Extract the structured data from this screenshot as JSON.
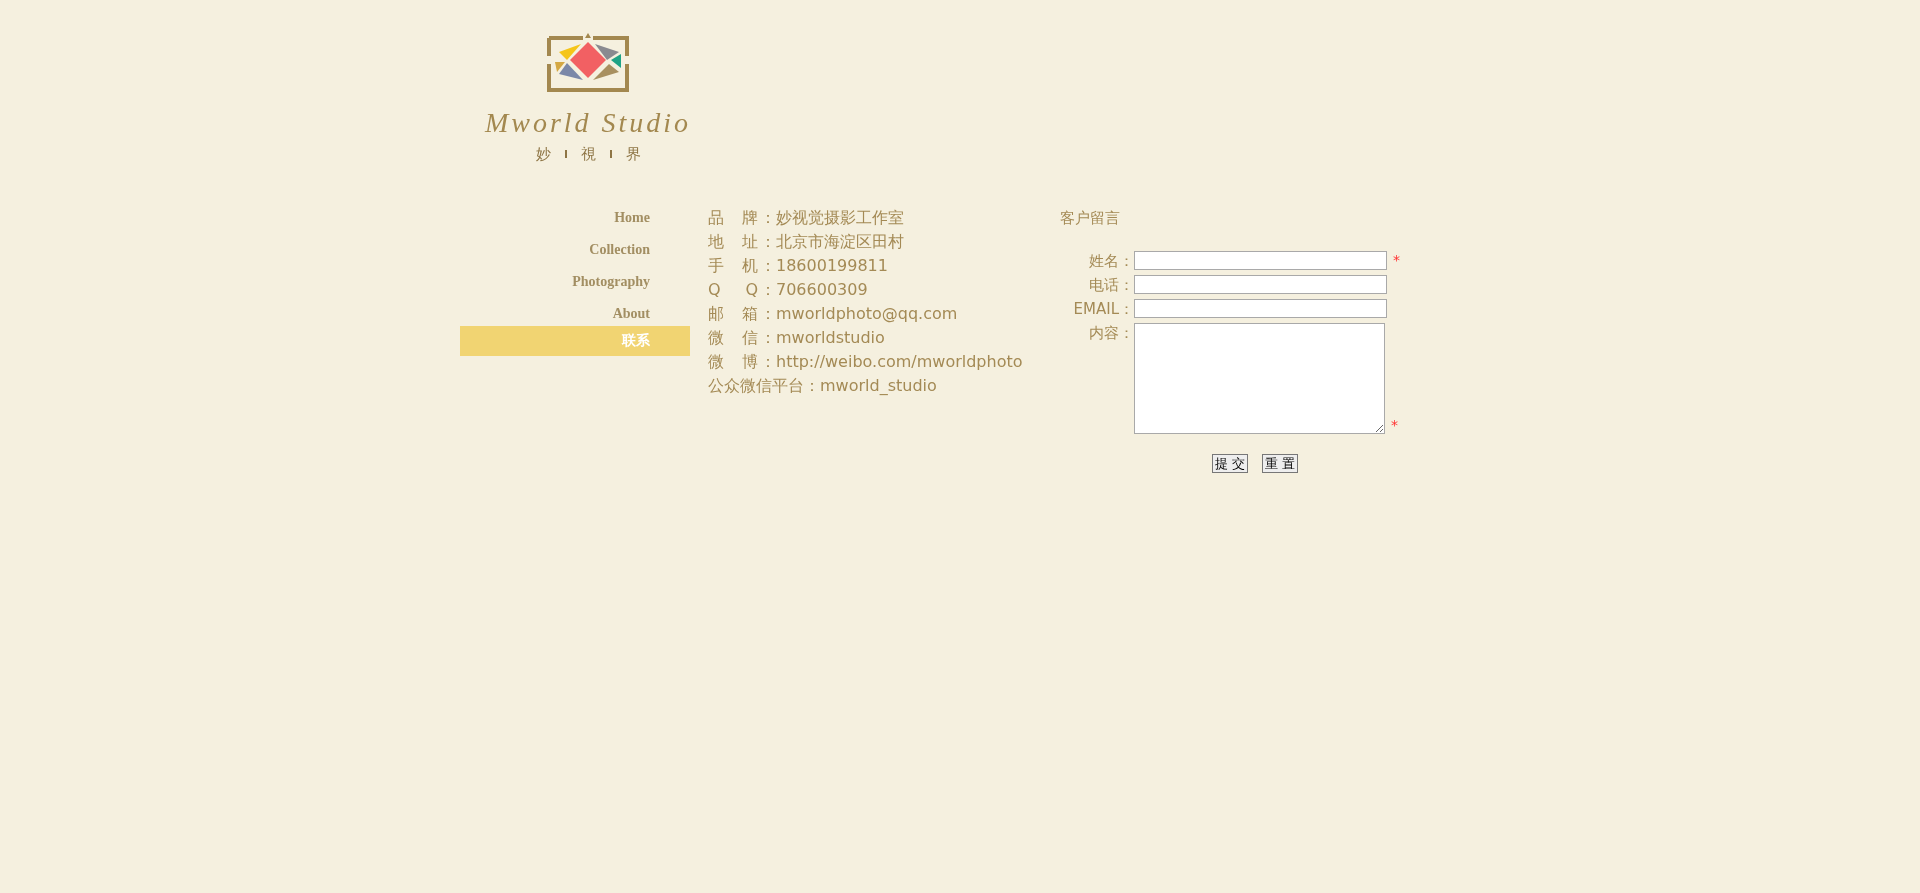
{
  "logo": {
    "wordmark": "Mworld Studio",
    "tagline": [
      "妙",
      "視",
      "界"
    ]
  },
  "nav": [
    {
      "label": "Home",
      "selected": false
    },
    {
      "label": "Collection",
      "selected": false
    },
    {
      "label": "Photography",
      "selected": false
    },
    {
      "label": "About",
      "selected": false
    },
    {
      "label": "联系",
      "selected": true
    }
  ],
  "contact": [
    {
      "label": "品牌",
      "value": "：妙视觉摄影工作室",
      "kind": "spaced"
    },
    {
      "label": "地址",
      "value": "：北京市海淀区田村",
      "kind": "spaced"
    },
    {
      "label": "手机",
      "value": "：18600199811",
      "kind": "spaced"
    },
    {
      "label": "Q Q",
      "value": "：706600309",
      "kind": "spaced"
    },
    {
      "label": "邮箱",
      "value": "：mworldphoto@qq.com",
      "kind": "spaced"
    },
    {
      "label": "微信",
      "value": "：mworldstudio",
      "kind": "spaced"
    },
    {
      "label": "微博",
      "value": "：http://weibo.com/mworldphoto",
      "kind": "spaced"
    },
    {
      "label": "公众微信平台",
      "value": "：mworld_studio",
      "kind": "plain"
    }
  ],
  "form": {
    "title": "客户留言",
    "fields": [
      {
        "label": "姓名：",
        "kind": "input",
        "required": true
      },
      {
        "label": "电话：",
        "kind": "input",
        "required": false
      },
      {
        "label": "EMAIL：",
        "kind": "input",
        "required": false
      },
      {
        "label": "内容：",
        "kind": "textarea",
        "required": true
      }
    ],
    "required_mark": "*",
    "buttons": [
      "提 交",
      "重 置"
    ]
  }
}
